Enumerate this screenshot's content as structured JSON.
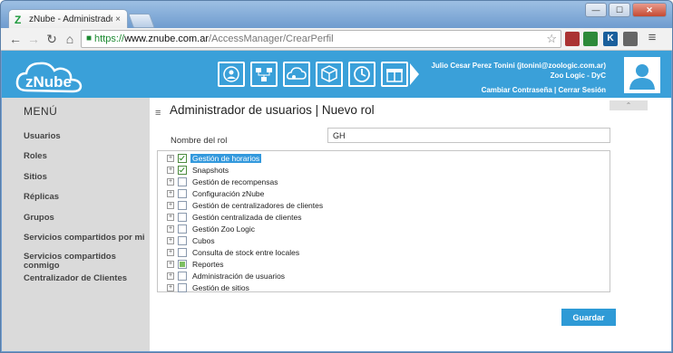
{
  "browser": {
    "tab_title": "zNube - Administrador de us",
    "tab_close": "×",
    "url_secure": "https://",
    "url_host": "www.znube.com.ar",
    "url_path": "/AccessManager/CrearPerfil",
    "back_icon": "←",
    "forward_icon": "→",
    "reload_icon": "↻",
    "home_icon": "⌂",
    "star_icon": "☆",
    "menu_icon": "≡",
    "win_min": "—",
    "win_max": "☐",
    "win_close": "✕",
    "ext_k": "K"
  },
  "header": {
    "logo_text": "zNube",
    "user_line1": "Julio Cesar Perez Tonini (jtonini@zoologic.com.ar)",
    "user_line2": "Zoo Logic - DyC",
    "change_password": "Cambiar Contraseña",
    "separator": "|",
    "logout": "Cerrar Sesión",
    "accent": "#3aa0d9"
  },
  "sidebar": {
    "title": "MENÚ",
    "items": [
      "Usuarios",
      "Roles",
      "Sitios",
      "Réplicas",
      "Grupos",
      "Servicios compartidos por mi",
      "Servicios compartidos conmigo",
      "Centralizador de Clientes"
    ]
  },
  "main": {
    "hamburger": "≡",
    "title": "Administrador de usuarios | Nuevo rol",
    "collapse_icon": "⌃",
    "field_label": "Nombre del rol",
    "field_value": "GH",
    "expander": "+",
    "tree": [
      {
        "label": "Gestión de horarios",
        "state": "checked",
        "selected": true
      },
      {
        "label": "Snapshots",
        "state": "checked",
        "selected": false
      },
      {
        "label": "Gestión de recompensas",
        "state": "unchecked",
        "selected": false
      },
      {
        "label": "Configuración zNube",
        "state": "unchecked",
        "selected": false
      },
      {
        "label": "Gestión de centralizadores de clientes",
        "state": "unchecked",
        "selected": false
      },
      {
        "label": "Gestión centralizada de clientes",
        "state": "unchecked",
        "selected": false
      },
      {
        "label": "Gestión Zoo Logic",
        "state": "unchecked",
        "selected": false
      },
      {
        "label": "Cubos",
        "state": "unchecked",
        "selected": false
      },
      {
        "label": "Consulta de stock entre locales",
        "state": "unchecked",
        "selected": false
      },
      {
        "label": "Reportes",
        "state": "partial",
        "selected": false
      },
      {
        "label": "Administración de usuarios",
        "state": "unchecked",
        "selected": false
      },
      {
        "label": "Gestión de sitios",
        "state": "unchecked",
        "selected": false
      }
    ],
    "save_label": "Guardar"
  },
  "module_icons": [
    "users-sync-icon",
    "org-chart-icon",
    "cloud-settings-icon",
    "cube-icon",
    "clock-icon",
    "gift-icon"
  ]
}
